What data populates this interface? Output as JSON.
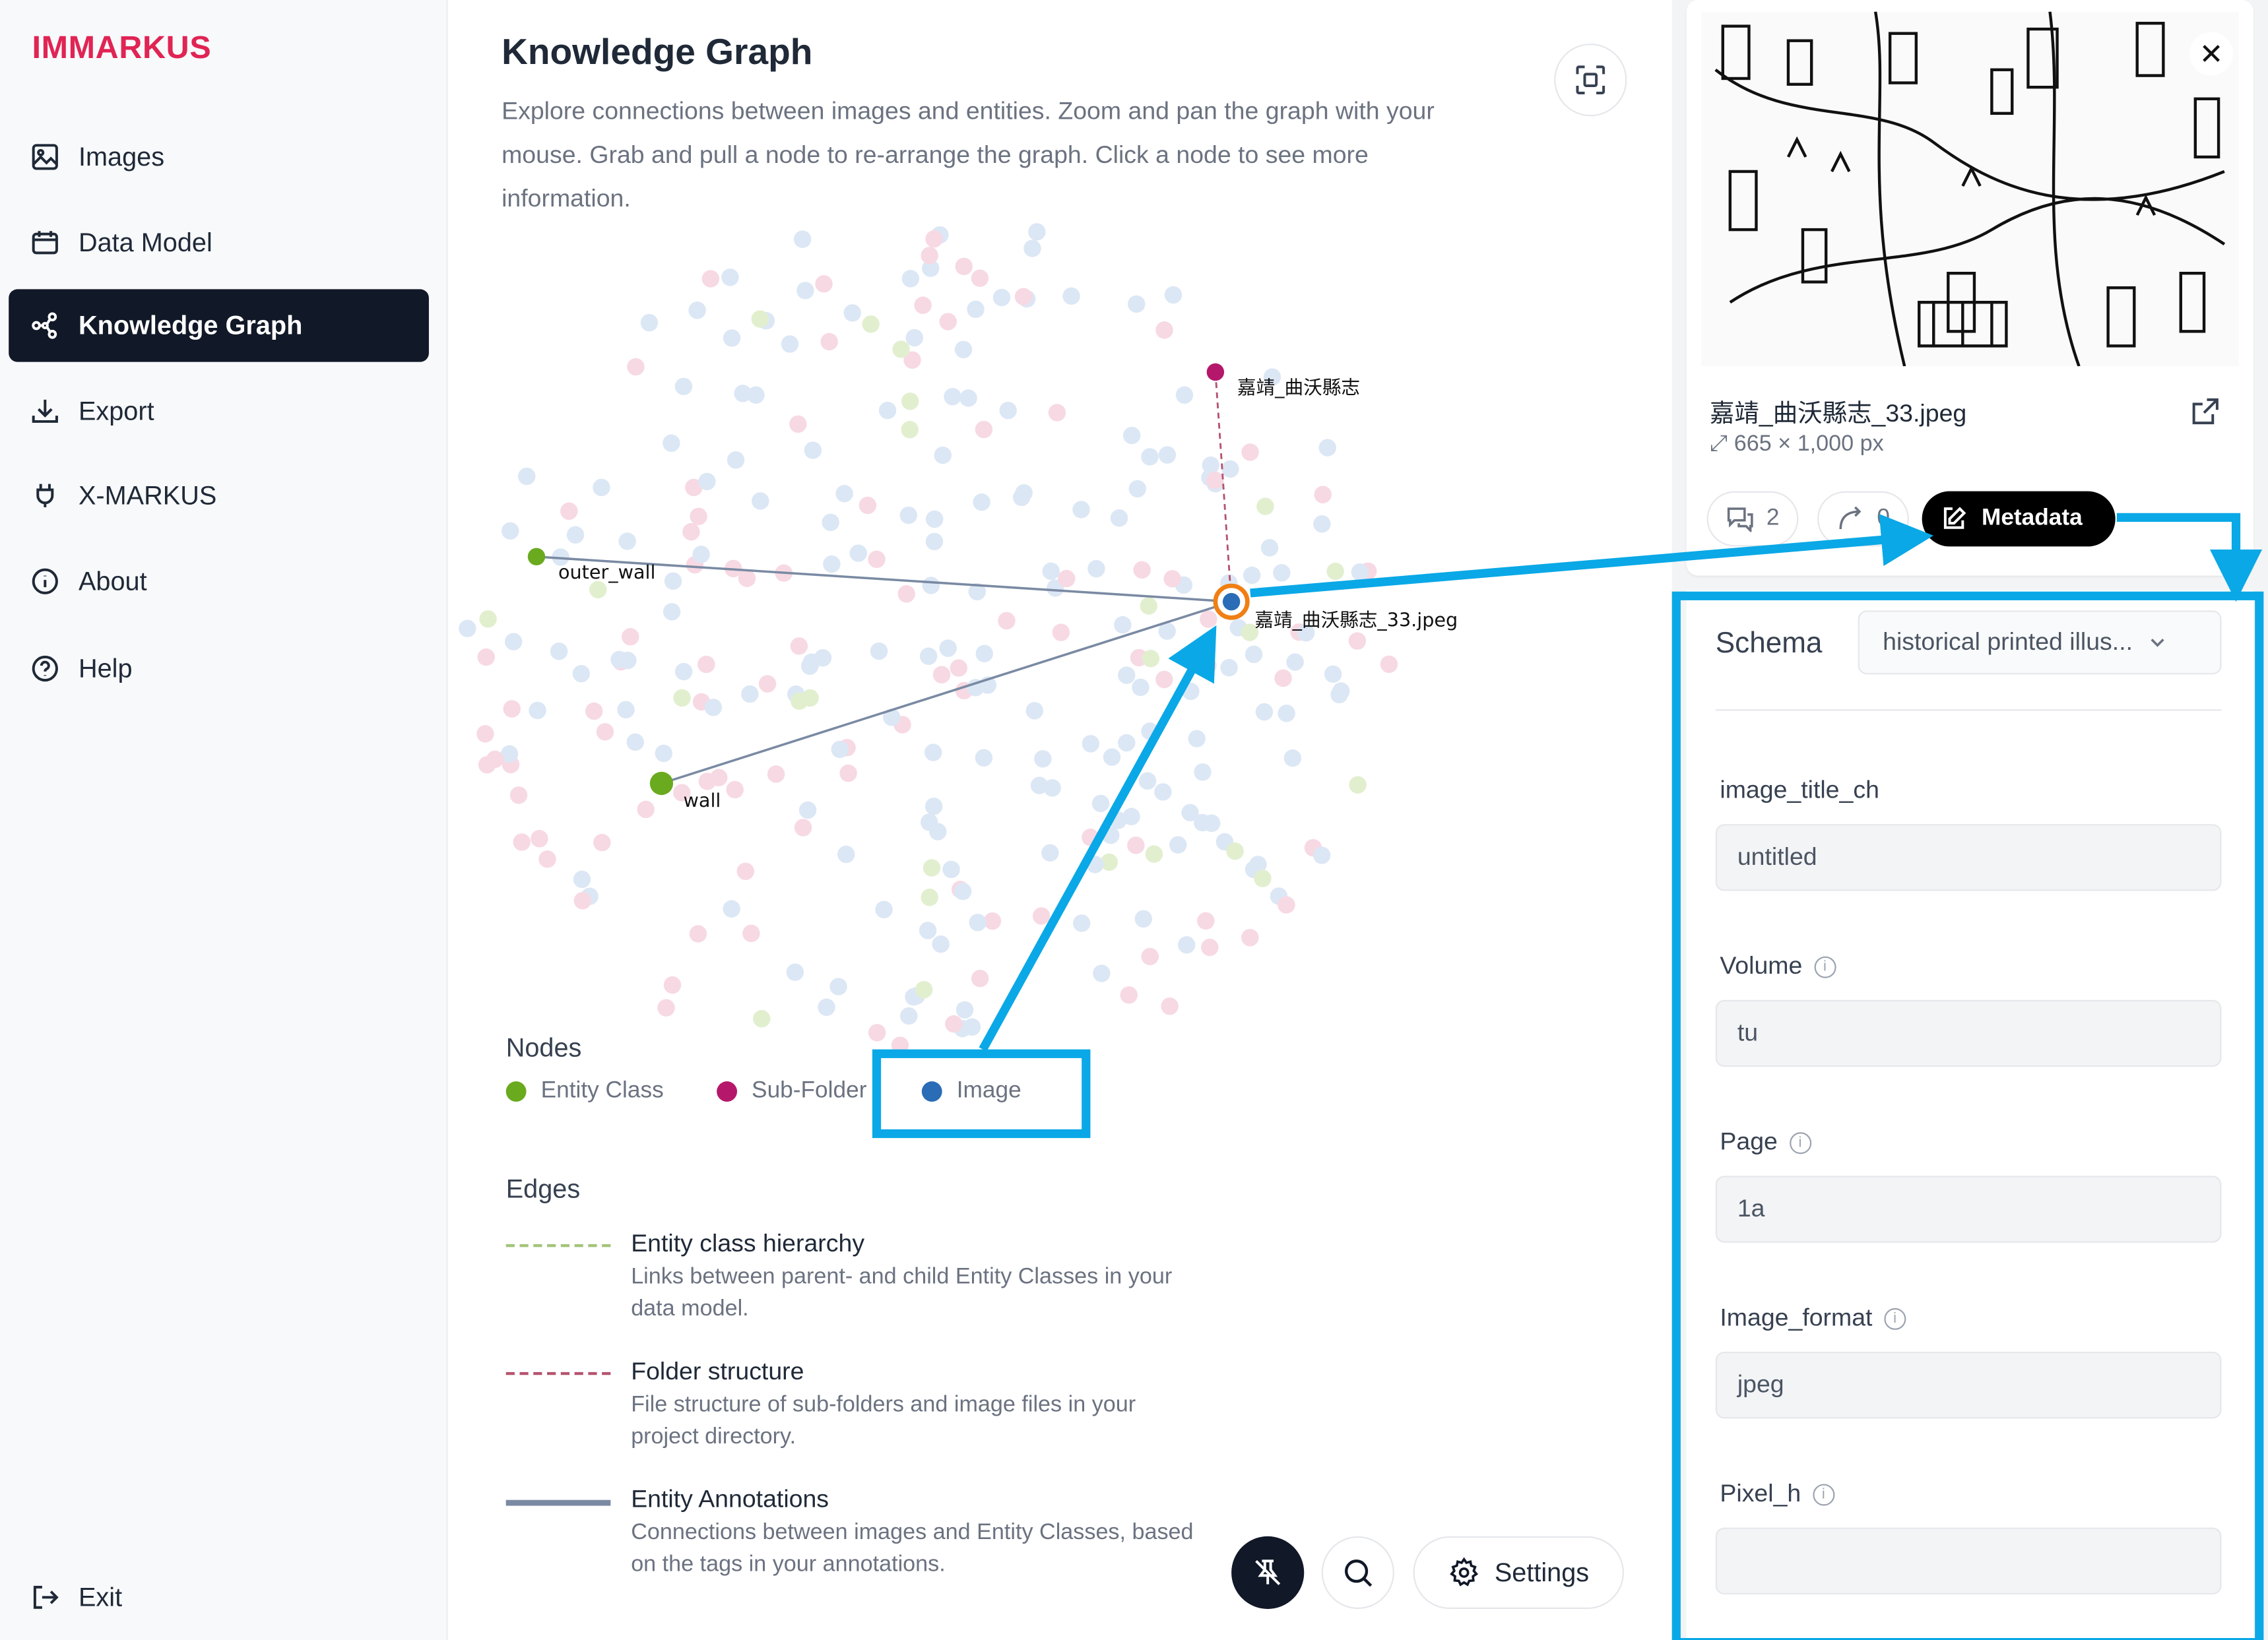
{
  "app": {
    "brand": "IMMARKUS"
  },
  "sidebar": {
    "items": [
      {
        "label": "Images",
        "icon": "image-icon"
      },
      {
        "label": "Data Model",
        "icon": "calendar-icon"
      },
      {
        "label": "Knowledge Graph",
        "icon": "graph-icon",
        "active": true
      },
      {
        "label": "Export",
        "icon": "download-icon"
      },
      {
        "label": "X-MARKUS",
        "icon": "plug-icon"
      },
      {
        "label": "About",
        "icon": "info-icon"
      },
      {
        "label": "Help",
        "icon": "help-icon"
      }
    ],
    "exit_label": "Exit"
  },
  "main": {
    "title": "Knowledge Graph",
    "description": "Explore connections between images and entities. Zoom and pan the graph with your mouse. Grab and pull a node to re-arrange the graph. Click a node to see more information.",
    "graph": {
      "nodes": {
        "subfolder": {
          "label": "嘉靖_曲沃縣志",
          "type": "Sub-Folder"
        },
        "image": {
          "label": "嘉靖_曲沃縣志_33.jpeg",
          "type": "Image",
          "selected": true
        },
        "outer_wall": {
          "label": "outer_wall",
          "type": "Entity Class"
        },
        "wall": {
          "label": "wall",
          "type": "Entity Class"
        }
      }
    },
    "legend": {
      "nodes_title": "Nodes",
      "node_types": [
        {
          "label": "Entity Class",
          "color": "#6aaa1e"
        },
        {
          "label": "Sub-Folder",
          "color": "#b5176b"
        },
        {
          "label": "Image",
          "color": "#2a6cb5"
        }
      ],
      "edges_title": "Edges",
      "edge_types": [
        {
          "name": "Entity class hierarchy",
          "desc": "Links between parent- and child Entity Classes in your data model.",
          "color": "#a3c47a",
          "style": "dashed"
        },
        {
          "name": "Folder structure",
          "desc": "File structure of sub-folders and image files in your project directory.",
          "color": "#b5536f",
          "style": "dashed"
        },
        {
          "name": "Entity Annotations",
          "desc": "Connections between images and Entity Classes, based on the tags in your annotations.",
          "color": "#7a8aa3",
          "style": "solid"
        }
      ]
    },
    "settings_label": "Settings"
  },
  "panel": {
    "file_name": "嘉靖_曲沃縣志_33.jpeg",
    "dimensions": "665 × 1,000 px",
    "annotations_count": "2",
    "relations_count": "0",
    "metadata_label": "Metadata",
    "schema_label": "Schema",
    "schema_value": "historical printed illus...",
    "fields": [
      {
        "label": "image_title_ch",
        "value": "untitled",
        "info": false
      },
      {
        "label": "Volume",
        "value": "tu",
        "info": true
      },
      {
        "label": "Page",
        "value": "1a",
        "info": true
      },
      {
        "label": "Image_format",
        "value": "jpeg",
        "info": true
      },
      {
        "label": "Pixel_h",
        "value": "",
        "info": true
      }
    ]
  },
  "colors": {
    "brand": "#e02454",
    "highlight": "#0aa8e6",
    "selected_ring": "#f07f14"
  }
}
